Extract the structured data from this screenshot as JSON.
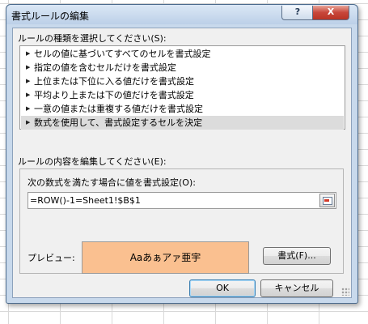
{
  "dialog": {
    "title": "書式ルールの編集",
    "help_label": "?",
    "close_label": "X"
  },
  "rule_type": {
    "label": "ルールの種類を選択してください(S):",
    "items": [
      {
        "label": "セルの値に基づいてすべてのセルを書式設定",
        "selected": false
      },
      {
        "label": "指定の値を含むセルだけを書式設定",
        "selected": false
      },
      {
        "label": "上位または下位に入る値だけを書式設定",
        "selected": false
      },
      {
        "label": "平均より上または下の値だけを書式設定",
        "selected": false
      },
      {
        "label": "一意の値または重複する値だけを書式設定",
        "selected": false
      },
      {
        "label": "数式を使用して、書式設定するセルを決定",
        "selected": true
      }
    ]
  },
  "rule_edit": {
    "label": "ルールの内容を編集してください(E):",
    "formula_label": "次の数式を満たす場合に値を書式設定(O):",
    "formula_value": "=ROW()-1=Sheet1!$B$1",
    "preview_label": "プレビュー:",
    "preview_text": "Aaあぁアァ亜宇",
    "preview_color": "#fac090",
    "format_button": "書式(F)..."
  },
  "buttons": {
    "ok": "OK",
    "cancel": "キャンセル"
  }
}
